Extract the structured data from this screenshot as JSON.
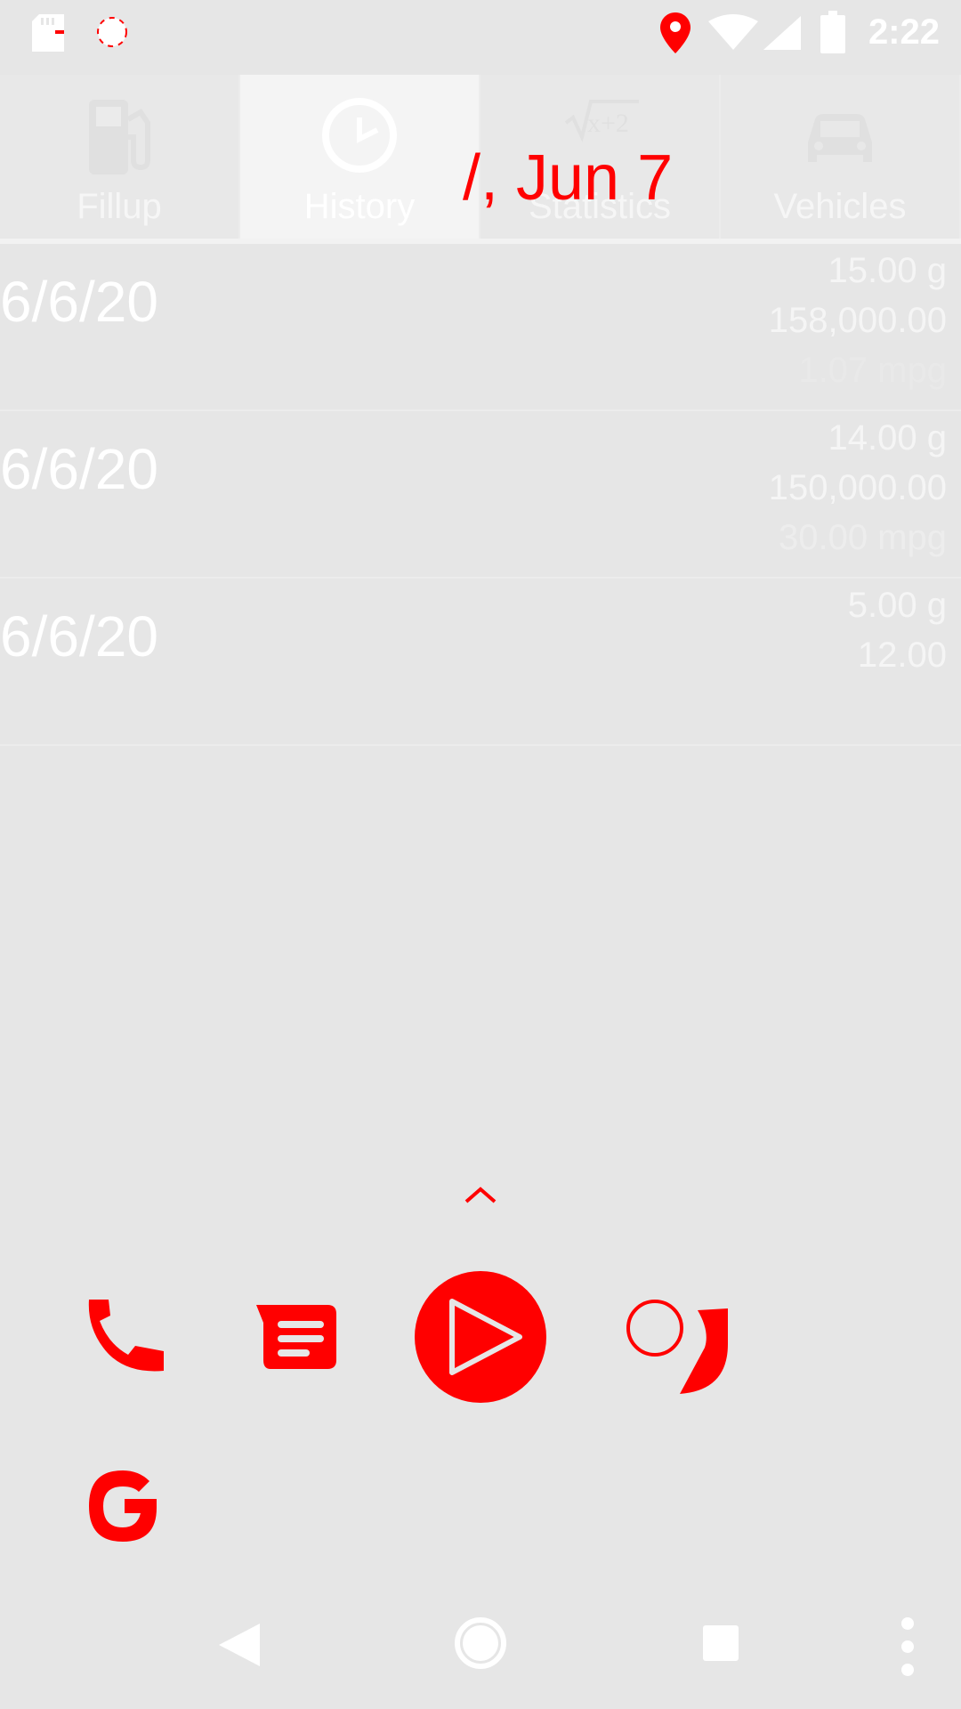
{
  "status_bar": {
    "time": "2:22",
    "icons": [
      "sd-card-icon",
      "sync-icon",
      "location-icon",
      "wifi-icon",
      "signal-icon",
      "battery-icon"
    ]
  },
  "tabs": [
    {
      "label": "Fillup",
      "icon": "fuel-pump-icon",
      "active": false
    },
    {
      "label": "History",
      "icon": "clock-icon",
      "active": true
    },
    {
      "label": "Statistics",
      "icon": "math-formula-icon",
      "active": false
    },
    {
      "label": "Vehicles",
      "icon": "car-icon",
      "active": false
    }
  ],
  "overlay": {
    "date_text": "/, Jun 7"
  },
  "history": {
    "rows": [
      {
        "date": "6/6/20",
        "gallons": "15.00 g",
        "odometer": "158,000.00",
        "mpg": "1.07 mpg"
      },
      {
        "date": "6/6/20",
        "gallons": "14.00 g",
        "odometer": "150,000.00",
        "mpg": "30.00 mpg"
      },
      {
        "date": "6/6/20",
        "gallons": "5.00 g",
        "odometer": "12.00",
        "mpg": ""
      }
    ]
  },
  "launcher": {
    "dock": [
      "phone-icon",
      "messages-icon",
      "play-store-icon",
      "chrome-icon"
    ],
    "row2": [
      "google-icon"
    ]
  },
  "nav_bar": {
    "buttons": [
      "back-icon",
      "home-icon",
      "recents-icon",
      "more-icon"
    ]
  },
  "colors": {
    "background": "#e6e6e6",
    "accent": "#ff0000",
    "text_light": "#ffffff"
  }
}
